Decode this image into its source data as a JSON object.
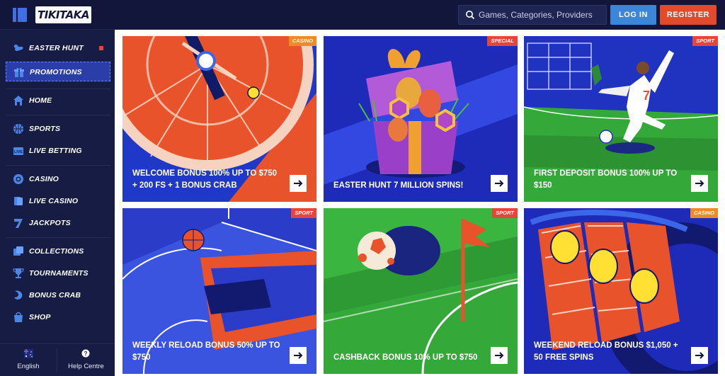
{
  "brand": {
    "logo_text": "TIKITAKA"
  },
  "header": {
    "search_placeholder": "Games, Categories, Providers",
    "login_label": "LOG IN",
    "register_label": "REGISTER"
  },
  "sidebar": {
    "items": [
      {
        "label": "EASTER HUNT",
        "icon": "bunny-icon"
      },
      {
        "label": "PROMOTIONS",
        "icon": "gift-icon"
      },
      {
        "label": "HOME",
        "icon": "home-icon"
      },
      {
        "label": "SPORTS",
        "icon": "sports-ball-icon"
      },
      {
        "label": "LIVE BETTING",
        "icon": "live-icon"
      },
      {
        "label": "CASINO",
        "icon": "casino-chip-icon"
      },
      {
        "label": "LIVE CASINO",
        "icon": "cards-icon"
      },
      {
        "label": "JACKPOTS",
        "icon": "seven-icon"
      },
      {
        "label": "COLLECTIONS",
        "icon": "collections-icon"
      },
      {
        "label": "TOURNAMENTS",
        "icon": "trophy-icon"
      },
      {
        "label": "BONUS CRAB",
        "icon": "crab-icon"
      },
      {
        "label": "SHOP",
        "icon": "shop-icon"
      }
    ],
    "footer": {
      "language_label": "English",
      "help_label": "Help Centre"
    }
  },
  "promotions": [
    {
      "title": "WELCOME BONUS 100% UP TO $750 + 200 FS + 1 BONUS CRAB",
      "tag": "CASINO"
    },
    {
      "title": "EASTER HUNT 7 MILLION SPINS!",
      "tag": "SPECIAL"
    },
    {
      "title": "FIRST DEPOSIT BONUS 100% UP TO $150",
      "tag": "SPORT"
    },
    {
      "title": "WEEKLY RELOAD BONUS 50% UP TO $750",
      "tag": "SPORT"
    },
    {
      "title": "CASHBACK BONUS 10% UP TO $750",
      "tag": "SPORT"
    },
    {
      "title": "WEEKEND RELOAD BONUS $1,050 + 50 FREE SPINS",
      "tag": "CASINO"
    }
  ],
  "colors": {
    "background": "#12163a",
    "sidebar": "#171c45",
    "accent_blue": "#3c86d9",
    "accent_red": "#e24a2a",
    "tag_orange": "#f08a24",
    "tag_red": "#e8453a"
  }
}
